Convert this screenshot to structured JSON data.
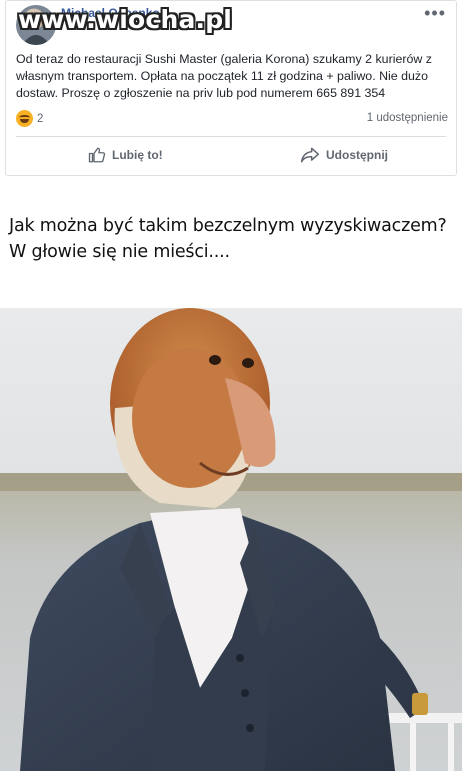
{
  "post": {
    "author": "Michael Ospenko",
    "watermark": "www.wiocha.pl",
    "more_icon": "more-options-icon",
    "text": "Od teraz do restauracji Sushi Master (galeria Korona) szukamy 2 kurierów z własnym transportem. Opłata na początek 11 zł godzina + paliwo. Nie dużo dostaw. Proszę o zgłoszenie na priv lub pod numerem 665 891 354",
    "reaction_count": "2",
    "shares": "1 udostępnienie",
    "like_label": "Lubię to!",
    "share_label": "Udostępnij"
  },
  "caption": {
    "line1": "Jak można być takim bezczelnym wyzyskiwaczem?",
    "line2": "W głowie się nie mieści...."
  },
  "colors": {
    "link": "#365899",
    "text": "#1d2129",
    "muted": "#606770",
    "card_border": "#dddfe2"
  }
}
